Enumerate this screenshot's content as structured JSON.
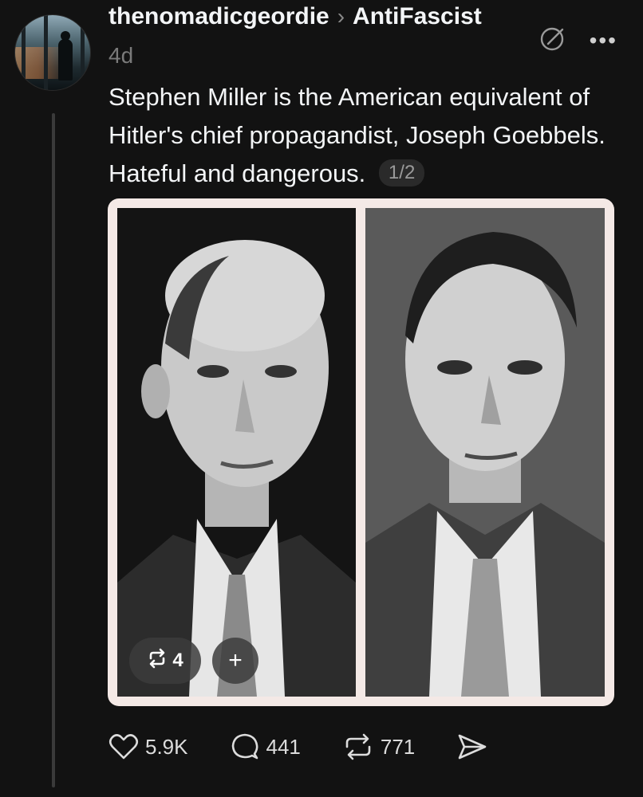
{
  "post": {
    "author": "thenomadicgeordie",
    "community": "AntiFascist",
    "time": "4d",
    "text": "Stephen Miller is the American equivalent of Hitler's chief propagandist, Joseph Goebbels. Hateful and dangerous.",
    "page_indicator": "1/2"
  },
  "media": {
    "repost_badge_count": "4",
    "add_label": "+"
  },
  "actions": {
    "likes": "5.9K",
    "replies": "441",
    "reposts": "771"
  },
  "icons": {
    "avatar": "avatar-photo",
    "chevron": "chevron-right-icon",
    "edit": "edit-icon",
    "more": "more-icon",
    "like": "heart-icon",
    "reply": "comment-icon",
    "repost": "repost-icon",
    "share": "send-icon"
  },
  "colors": {
    "background": "#121212",
    "text": "#f3f5f7",
    "muted": "#7a7a7a",
    "media_frame": "#f4e9e6"
  }
}
